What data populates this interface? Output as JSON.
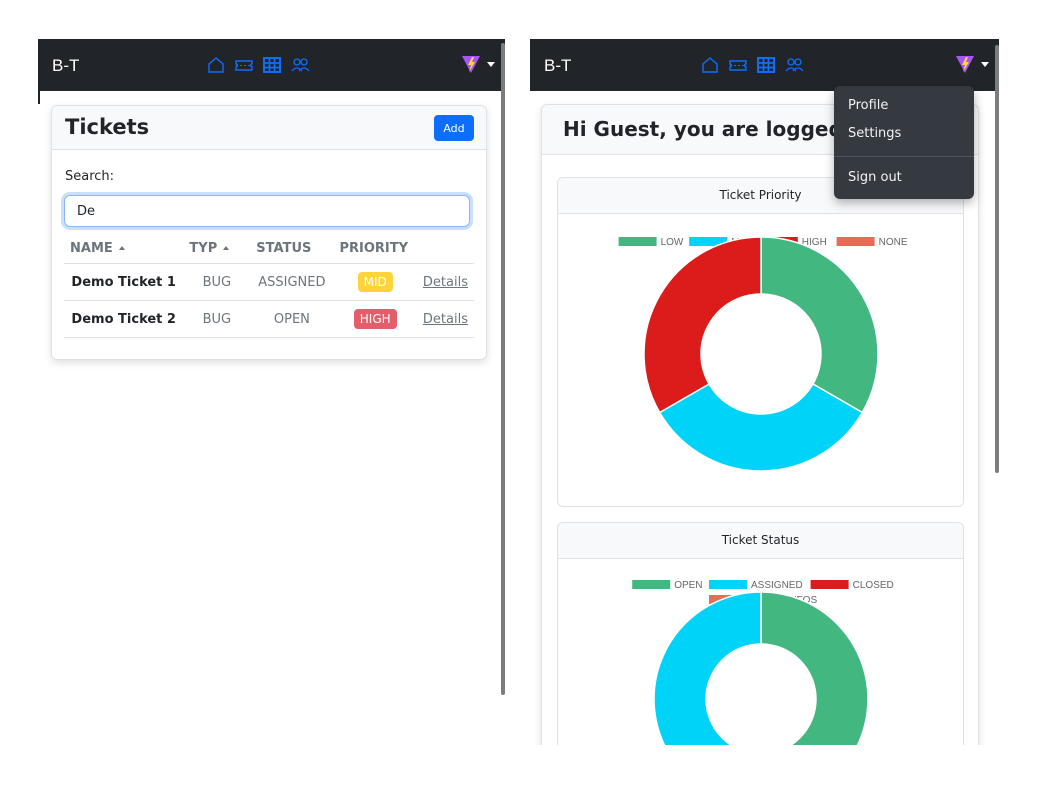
{
  "colors": {
    "navbar": "#212529",
    "accent": "#0d6efd",
    "low": "#42b77f",
    "mid": "#00d3f8",
    "high": "#dc1b1b",
    "none": "#e76b55",
    "mid_badge": "#ffd43b",
    "high_badge": "#e35d6a"
  },
  "left": {
    "navbar": {
      "brand": "B-T",
      "icons": [
        "home-icon",
        "ticket-icon",
        "table-icon",
        "people-icon"
      ],
      "avatar": "vite-logo-icon"
    },
    "tickets": {
      "title": "Tickets",
      "add_label": "Add",
      "search_label": "Search:",
      "search_value": "De",
      "columns": [
        "NAME",
        "TYP",
        "STATUS",
        "PRIORITY"
      ],
      "rows": [
        {
          "name": "Demo Ticket 1",
          "type": "BUG",
          "status": "ASSIGNED",
          "priority": "MID",
          "link": "Details"
        },
        {
          "name": "Demo Ticket 2",
          "type": "BUG",
          "status": "OPEN",
          "priority": "HIGH",
          "link": "Details"
        }
      ]
    }
  },
  "right": {
    "navbar": {
      "brand": "B-T"
    },
    "greeting": "Hi Guest, you are logged i",
    "dropdown": {
      "items": [
        "Profile",
        "Settings",
        "Sign out"
      ]
    }
  },
  "chart_data": [
    {
      "type": "pie",
      "title": "Ticket Priority",
      "categories": [
        "LOW",
        "MID",
        "HIGH",
        "NONE"
      ],
      "values": [
        1,
        1,
        1,
        0
      ],
      "legend": "top"
    },
    {
      "type": "pie",
      "title": "Ticket Status",
      "categories": [
        "OPEN",
        "ASSIGNED",
        "CLOSED",
        "MORE_INFOS"
      ],
      "values": [
        1,
        1,
        0,
        0
      ],
      "legend": "top"
    }
  ]
}
